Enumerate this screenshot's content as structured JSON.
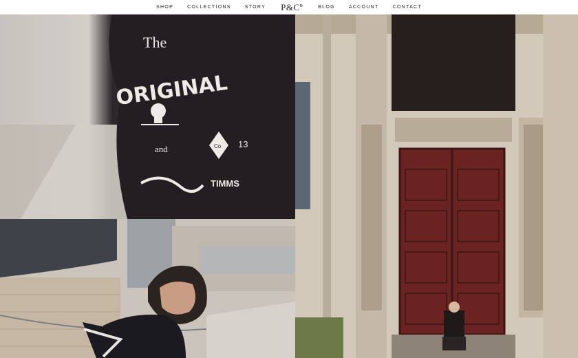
{
  "nav": {
    "items": [
      "SHOP",
      "COLLECTIONS",
      "STORY",
      "BLOG",
      "ACCOUNT",
      "CONTACT"
    ],
    "logo": "P&Cº"
  },
  "tiles": {
    "tshirt_print": {
      "line1": "The",
      "line2": "ORIGINAL",
      "line3": "and",
      "line4": "Co",
      "line5": "13",
      "line6": "TIMMS"
    },
    "doorway": {},
    "portrait": {}
  }
}
